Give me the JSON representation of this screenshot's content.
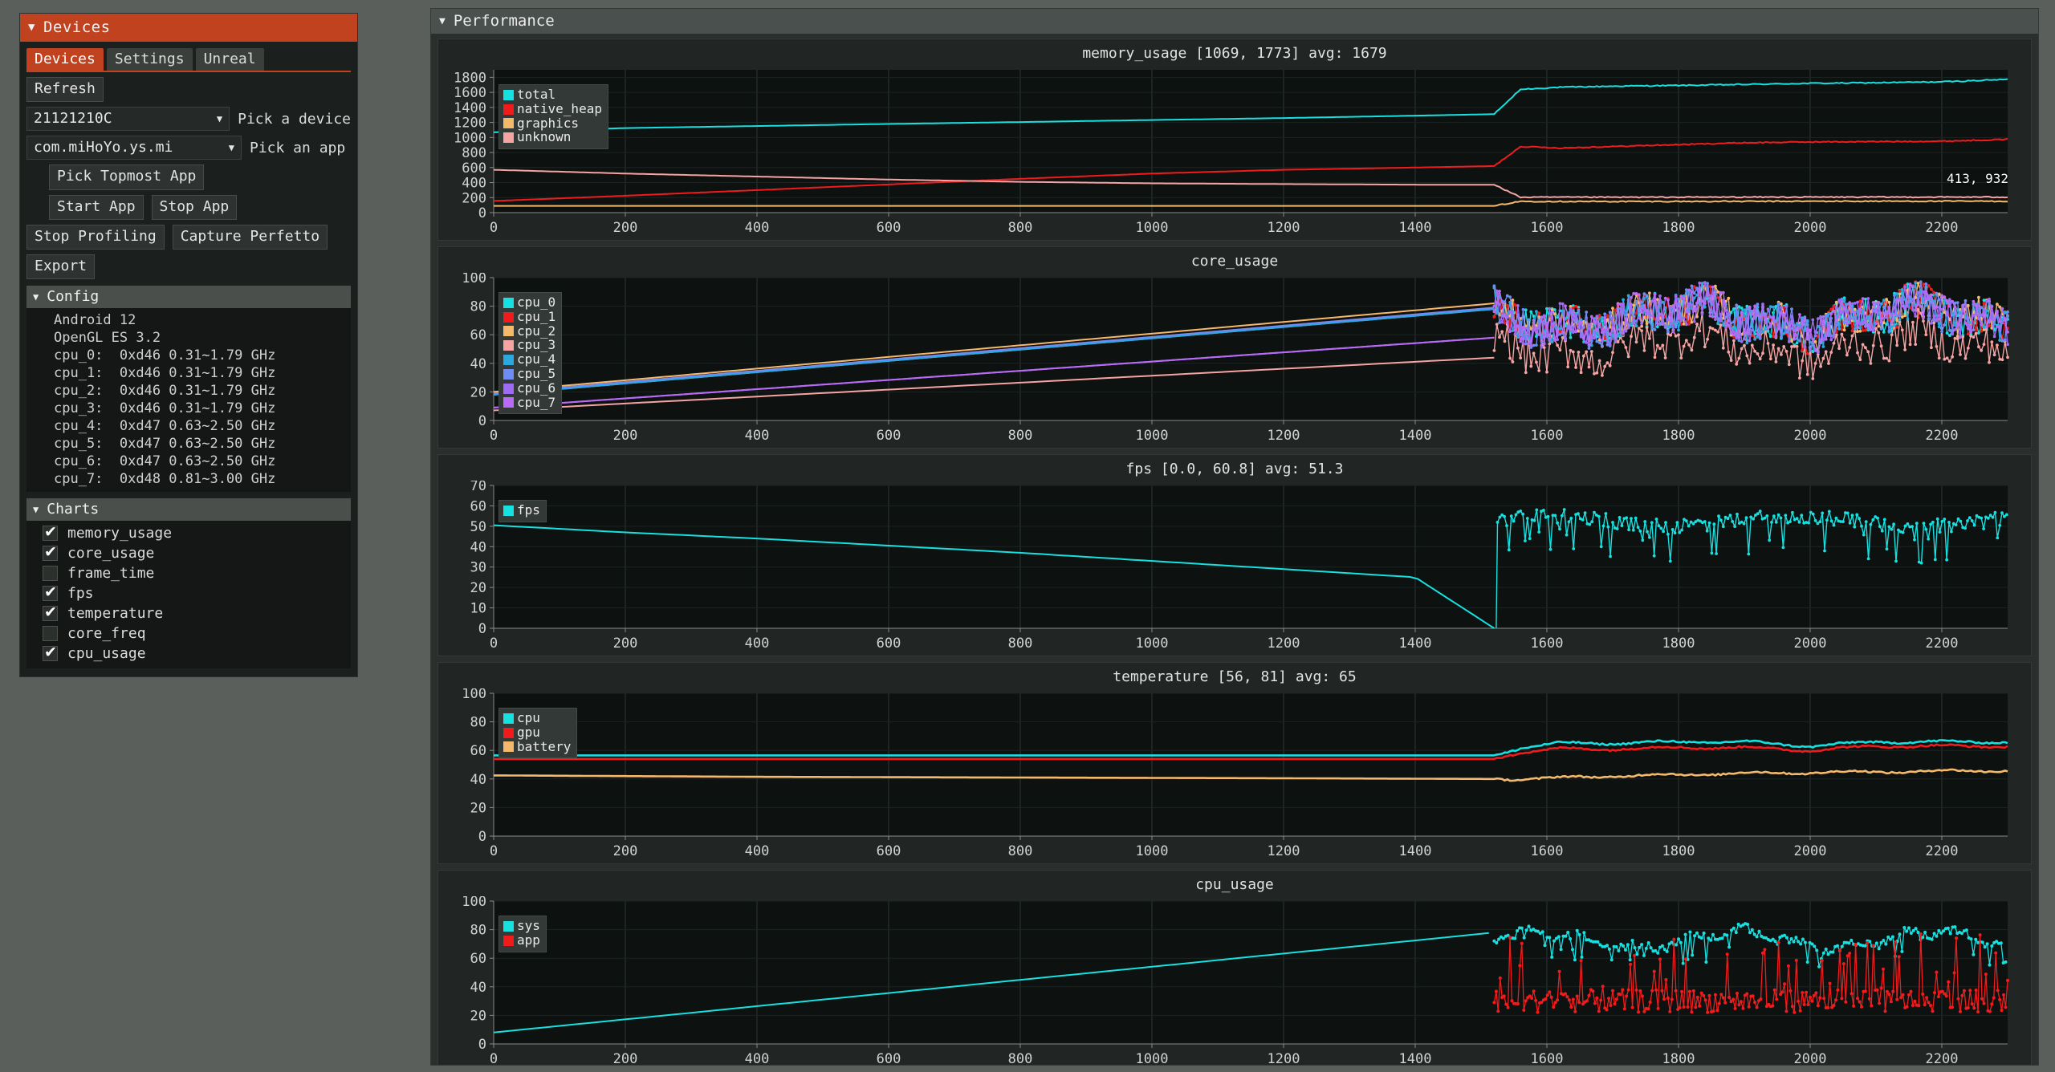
{
  "devices_panel": {
    "title": "Devices",
    "collapse_icon": "triangle-down-icon",
    "tabs": [
      {
        "label": "Devices",
        "active": true
      },
      {
        "label": "Settings",
        "active": false
      },
      {
        "label": "Unreal",
        "active": false
      }
    ],
    "refresh_button": "Refresh",
    "device_select": {
      "value": "21121210C",
      "label": "Pick a device",
      "chevron": "chevron-down-icon"
    },
    "app_select": {
      "value": "com.miHoYo.ys.mi",
      "label": "Pick an app",
      "chevron": "chevron-down-icon"
    },
    "pick_topmost_button": "Pick Topmost App",
    "start_app_button": "Start App",
    "stop_app_button": "Stop App",
    "stop_profiling_button": "Stop Profiling",
    "capture_perfetto_button": "Capture Perfetto",
    "export_button": "Export",
    "config": {
      "title": "Config",
      "collapse_icon": "triangle-down-icon",
      "lines": [
        "Android 12",
        "OpenGL ES 3.2",
        "cpu_0:  0xd46 0.31~1.79 GHz",
        "cpu_1:  0xd46 0.31~1.79 GHz",
        "cpu_2:  0xd46 0.31~1.79 GHz",
        "cpu_3:  0xd46 0.31~1.79 GHz",
        "cpu_4:  0xd47 0.63~2.50 GHz",
        "cpu_5:  0xd47 0.63~2.50 GHz",
        "cpu_6:  0xd47 0.63~2.50 GHz",
        "cpu_7:  0xd48 0.81~3.00 GHz"
      ]
    },
    "charts_section": {
      "title": "Charts",
      "collapse_icon": "triangle-down-icon",
      "items": [
        {
          "label": "memory_usage",
          "checked": true
        },
        {
          "label": "core_usage",
          "checked": true
        },
        {
          "label": "frame_time",
          "checked": false
        },
        {
          "label": "fps",
          "checked": true
        },
        {
          "label": "temperature",
          "checked": true
        },
        {
          "label": "core_freq",
          "checked": false
        },
        {
          "label": "cpu_usage",
          "checked": true
        }
      ]
    }
  },
  "performance_panel": {
    "title": "Performance",
    "collapse_icon": "triangle-down-icon"
  },
  "colors": {
    "accent": "#c0421e",
    "panel_bg": "#1b1f1d",
    "plot_bg": "#0d1110",
    "cyan": "#17e0e0",
    "red": "#f01c1c",
    "orange": "#f5b96b",
    "pink": "#f5a3a3",
    "blue": "#4da6f0",
    "blue2": "#6f8cf5",
    "purple": "#9f6bf5",
    "violet": "#b96bf5"
  },
  "chart_data": [
    {
      "type": "line",
      "name": "memory_usage",
      "title": "memory_usage [1069, 1773] avg: 1679",
      "xlabel": "",
      "ylabel": "",
      "xlim": [
        0,
        2300
      ],
      "ylim": [
        0,
        1900
      ],
      "xticks": [
        0,
        200,
        400,
        600,
        800,
        1000,
        1200,
        1400,
        1600,
        1800,
        2000,
        2200
      ],
      "yticks": [
        0,
        200,
        400,
        600,
        800,
        1000,
        1200,
        1400,
        1600,
        1800
      ],
      "grid": true,
      "legend_position": "top-left",
      "annotation": "413, 932",
      "series": [
        {
          "name": "total",
          "color": "#17e0e0",
          "x": [
            0,
            200,
            400,
            600,
            800,
            1000,
            1200,
            1400,
            1520,
            1560,
            1620,
            1700,
            1800,
            1900,
            2000,
            2100,
            2200,
            2300
          ],
          "y": [
            1069,
            1125,
            1152,
            1180,
            1205,
            1232,
            1258,
            1290,
            1310,
            1640,
            1668,
            1682,
            1692,
            1705,
            1720,
            1728,
            1740,
            1773
          ]
        },
        {
          "name": "native_heap",
          "color": "#f01c1c",
          "x": [
            0,
            200,
            400,
            600,
            800,
            1000,
            1200,
            1400,
            1520,
            1560,
            1620,
            1700,
            1800,
            1900,
            2000,
            2100,
            2200,
            2300
          ],
          "y": [
            155,
            225,
            300,
            375,
            450,
            520,
            570,
            600,
            620,
            880,
            860,
            880,
            905,
            930,
            940,
            945,
            950,
            975
          ]
        },
        {
          "name": "graphics",
          "color": "#f5b96b",
          "x": [
            0,
            200,
            400,
            600,
            800,
            1000,
            1200,
            1400,
            1520,
            1560,
            1700,
            1900,
            2100,
            2300
          ],
          "y": [
            90,
            90,
            90,
            90,
            90,
            90,
            90,
            90,
            90,
            150,
            148,
            150,
            152,
            152
          ]
        },
        {
          "name": "unknown",
          "color": "#f5a3a3",
          "x": [
            0,
            200,
            400,
            600,
            800,
            1000,
            1200,
            1400,
            1520,
            1560,
            1700,
            1900,
            2100,
            2300
          ],
          "y": [
            570,
            520,
            480,
            440,
            410,
            390,
            380,
            372,
            370,
            205,
            205,
            207,
            207,
            207
          ]
        }
      ]
    },
    {
      "type": "line",
      "name": "core_usage",
      "title": "core_usage",
      "xlim": [
        0,
        2300
      ],
      "ylim": [
        0,
        100
      ],
      "xticks": [
        0,
        200,
        400,
        600,
        800,
        1000,
        1200,
        1400,
        1600,
        1800,
        2000,
        2200
      ],
      "yticks": [
        0,
        20,
        40,
        60,
        80,
        100
      ],
      "grid": true,
      "legend_position": "top-left",
      "series": [
        {
          "name": "cpu_0",
          "color": "#17e0e0"
        },
        {
          "name": "cpu_1",
          "color": "#f01c1c"
        },
        {
          "name": "cpu_2",
          "color": "#f5b96b"
        },
        {
          "name": "cpu_3",
          "color": "#f5a3a3"
        },
        {
          "name": "cpu_4",
          "color": "#2ca8e0"
        },
        {
          "name": "cpu_5",
          "color": "#6f8cf5"
        },
        {
          "name": "cpu_6",
          "color": "#9f6bf5"
        },
        {
          "name": "cpu_7",
          "color": "#b96bf5"
        }
      ],
      "note": "ramp lines 8-20 to 75-85 until x=1520, then dense noisy band 30-95"
    },
    {
      "type": "line",
      "name": "fps",
      "title": "fps [0.0, 60.8] avg: 51.3",
      "xlim": [
        0,
        2300
      ],
      "ylim": [
        0,
        70
      ],
      "xticks": [
        0,
        200,
        400,
        600,
        800,
        1000,
        1200,
        1400,
        1600,
        1800,
        2000,
        2200
      ],
      "yticks": [
        0,
        10,
        20,
        30,
        40,
        50,
        60,
        70
      ],
      "grid": true,
      "legend_position": "top-left",
      "series": [
        {
          "name": "fps",
          "color": "#17e0e0",
          "x": [
            0,
            200,
            400,
            600,
            800,
            1000,
            1200,
            1400,
            1520,
            1525,
            1600,
            1800,
            2000,
            2200,
            2300
          ],
          "y": [
            50.5,
            47,
            44,
            40.5,
            37,
            33,
            29,
            25,
            0,
            60.5,
            58,
            57,
            57,
            58,
            58
          ]
        }
      ],
      "note": "after x=1525 noisy band between 35 and 61"
    },
    {
      "type": "line",
      "name": "temperature",
      "title": "temperature [56, 81] avg: 65",
      "xlim": [
        0,
        2300
      ],
      "ylim": [
        0,
        100
      ],
      "xticks": [
        0,
        200,
        400,
        600,
        800,
        1000,
        1200,
        1400,
        1600,
        1800,
        2000,
        2200
      ],
      "yticks": [
        0,
        20,
        40,
        60,
        80,
        100
      ],
      "grid": true,
      "legend_position": "top-left",
      "series": [
        {
          "name": "cpu",
          "color": "#17e0e0",
          "x": [
            0,
            400,
            800,
            1200,
            1520,
            1560,
            1620,
            1700,
            1800,
            1900,
            2000,
            2100,
            2200,
            2300
          ],
          "y": [
            56.5,
            56.5,
            56.5,
            56.5,
            56.5,
            62,
            65,
            65,
            66,
            66,
            63,
            66,
            66,
            66
          ]
        },
        {
          "name": "gpu",
          "color": "#f01c1c",
          "x": [
            0,
            400,
            800,
            1200,
            1520,
            1560,
            1620,
            1700,
            1800,
            1900,
            2000,
            2100,
            2200,
            2300
          ],
          "y": [
            54,
            54,
            54,
            54,
            54,
            59,
            61,
            61,
            62,
            62,
            60,
            63,
            63,
            63
          ]
        },
        {
          "name": "battery",
          "color": "#f5b96b",
          "x": [
            0,
            400,
            800,
            1200,
            1520,
            1560,
            1700,
            1900,
            2100,
            2300
          ],
          "y": [
            42.5,
            41.5,
            41,
            40.5,
            40,
            40,
            42,
            44,
            45,
            46
          ]
        }
      ]
    },
    {
      "type": "line",
      "name": "cpu_usage",
      "title": "cpu_usage",
      "xlim": [
        0,
        2300
      ],
      "ylim": [
        0,
        100
      ],
      "xticks": [
        0,
        200,
        400,
        600,
        800,
        1000,
        1200,
        1400,
        1600,
        1800,
        2000,
        2200
      ],
      "yticks": [
        0,
        20,
        40,
        60,
        80,
        100
      ],
      "grid": true,
      "legend_position": "top-left",
      "series": [
        {
          "name": "sys",
          "color": "#17e0e0"
        },
        {
          "name": "app",
          "color": "#f01c1c"
        }
      ],
      "note": "sys ramps 8->78 until x=1520 then noisy 55-85; app noisy spikes 10-80 after x=1520"
    }
  ]
}
